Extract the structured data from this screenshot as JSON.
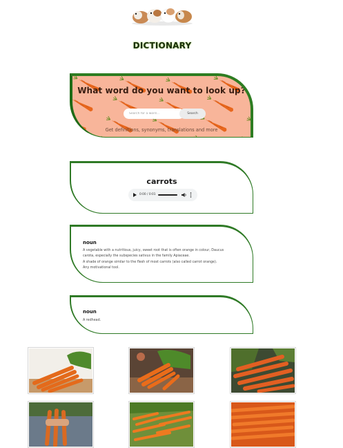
{
  "header": {
    "logo_icon": "guinea-pigs-logo-icon",
    "title": "DICTIONARY"
  },
  "search": {
    "prompt": "What word do you want to look up?",
    "placeholder": "Search for a word...",
    "button_label": "Search",
    "subtitle": "Get definitions, synonyms, translations and more",
    "hero_background": "carrots-pattern"
  },
  "result": {
    "word": "carrots",
    "audio": {
      "time": "0:00 / 0:01",
      "icons": [
        "play-icon",
        "volume-icon",
        "more-options-icon"
      ]
    }
  },
  "meanings": [
    {
      "part_of_speech": "noun",
      "definitions": [
        "A vegetable with a nutritious, juicy, sweet root that is often orange in colour, Daucus",
        "carota, especially the subspecies sativus in the family Apiaceae.",
        "A shade of orange similar to the flesh of most carrots (also called carrot orange).",
        "Any motivational tool."
      ]
    },
    {
      "part_of_speech": "noun",
      "definitions": [
        "A redhead."
      ]
    }
  ],
  "gallery": [
    {
      "subject": "carrots-on-wooden-board"
    },
    {
      "subject": "carrots-bunch-with-leaves"
    },
    {
      "subject": "carrots-pile-with-greens"
    },
    {
      "subject": "carrots-held-in-hand"
    },
    {
      "subject": "carrots-in-crate"
    },
    {
      "subject": "carrots-heap-closeup"
    }
  ],
  "colors": {
    "accent_green": "#2e7d22",
    "hero_peach": "#f8b59a",
    "carrot_orange": "#e8671d"
  }
}
